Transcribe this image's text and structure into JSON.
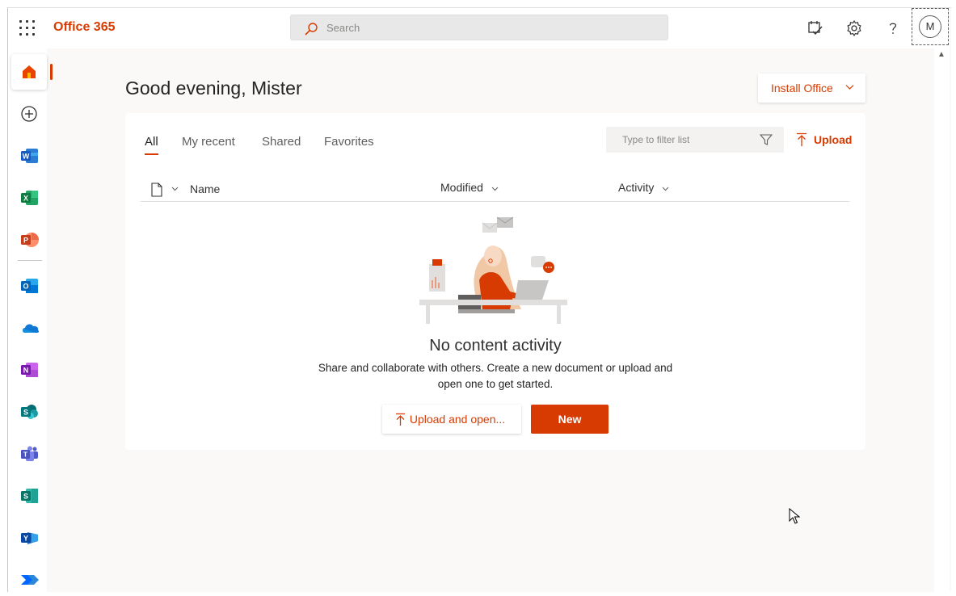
{
  "header": {
    "brand": "Office 365",
    "search_placeholder": "Search",
    "avatar_initial": "M"
  },
  "rail": {
    "items": [
      "home-icon",
      "create-icon",
      "word-icon",
      "excel-icon",
      "powerpoint-icon",
      "outlook-icon",
      "onedrive-icon",
      "onenote-icon",
      "sharepoint-icon",
      "teams-icon",
      "sway-icon",
      "yammer-icon",
      "power-automate-icon"
    ]
  },
  "main": {
    "greeting": "Good evening, Mister",
    "install_label": "Install Office",
    "tabs": [
      {
        "label": "All",
        "active": true
      },
      {
        "label": "My recent",
        "active": false
      },
      {
        "label": "Shared",
        "active": false
      },
      {
        "label": "Favorites",
        "active": false
      }
    ],
    "filter_placeholder": "Type to filter list",
    "upload_label": "Upload",
    "columns": {
      "name": "Name",
      "modified": "Modified",
      "activity": "Activity"
    },
    "empty_title": "No content activity",
    "empty_desc": "Share and collaborate with others. Create a new document or upload and open one to get started.",
    "upload_open_label": "Upload and open...",
    "new_label": "New"
  },
  "colors": {
    "accent": "#d83b01",
    "background": "#faf9f8"
  }
}
